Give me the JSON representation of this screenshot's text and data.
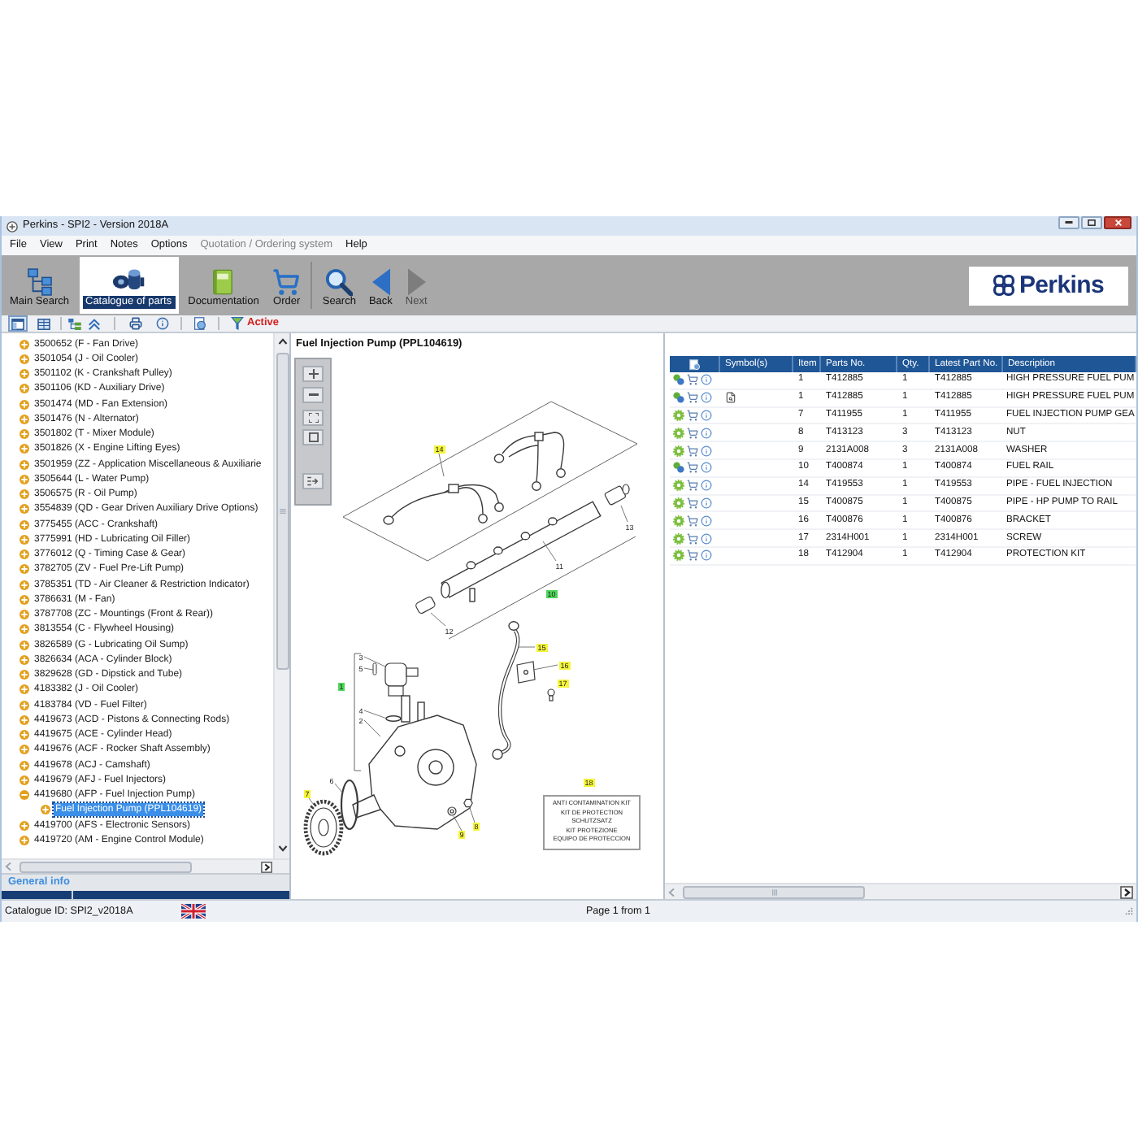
{
  "window": {
    "title": "Perkins - SPI2 - Version 2018A"
  },
  "menu": [
    {
      "label": "File",
      "disabled": false
    },
    {
      "label": "View",
      "disabled": false
    },
    {
      "label": "Print",
      "disabled": false
    },
    {
      "label": "Notes",
      "disabled": false
    },
    {
      "label": "Options",
      "disabled": false
    },
    {
      "label": "Quotation / Ordering system",
      "disabled": true
    },
    {
      "label": "Help",
      "disabled": false
    }
  ],
  "toolbar": {
    "groups": [
      [
        {
          "kind": "tree",
          "label": "Main Search",
          "selected": false,
          "disabled": false
        },
        {
          "kind": "parts",
          "label": "Catalogue of parts",
          "selected": true,
          "disabled": false
        },
        {
          "kind": "book",
          "label": "Documentation",
          "selected": false,
          "disabled": false
        },
        {
          "kind": "cart",
          "label": "Order",
          "selected": false,
          "disabled": false
        }
      ],
      [
        {
          "kind": "search",
          "label": "Search",
          "selected": false,
          "disabled": false
        },
        {
          "kind": "back",
          "label": "Back",
          "selected": false,
          "disabled": false
        },
        {
          "kind": "next",
          "label": "Next",
          "selected": false,
          "disabled": true
        }
      ]
    ],
    "logo": "Perkins"
  },
  "view_toolbar": {
    "view_buttons": [
      {
        "selected": true
      },
      {
        "selected": false
      }
    ],
    "filter": {
      "label": "Active"
    }
  },
  "tree": {
    "items": [
      {
        "label": "3500652 (F - Fan Drive)",
        "expanded": false,
        "selected": false
      },
      {
        "label": "3501054 (J - Oil Cooler)",
        "expanded": false,
        "selected": false
      },
      {
        "label": "3501102 (K - Crankshaft Pulley)",
        "expanded": false,
        "selected": false
      },
      {
        "label": "3501106 (KD - Auxiliary Drive)",
        "expanded": false,
        "selected": false
      },
      {
        "label": "3501474 (MD - Fan Extension)",
        "expanded": false,
        "selected": false
      },
      {
        "label": "3501476 (N - Alternator)",
        "expanded": false,
        "selected": false
      },
      {
        "label": "3501802 (T - Mixer Module)",
        "expanded": false,
        "selected": false
      },
      {
        "label": "3501826 (X - Engine Lifting Eyes)",
        "expanded": false,
        "selected": false
      },
      {
        "label": "3501959 (ZZ - Application Miscellaneous & Auxiliarie",
        "expanded": false,
        "selected": false
      },
      {
        "label": "3505644 (L - Water Pump)",
        "expanded": false,
        "selected": false
      },
      {
        "label": "3506575 (R - Oil Pump)",
        "expanded": false,
        "selected": false
      },
      {
        "label": "3554839 (QD - Gear Driven Auxiliary Drive Options)",
        "expanded": false,
        "selected": false
      },
      {
        "label": "3775455 (ACC - Crankshaft)",
        "expanded": false,
        "selected": false
      },
      {
        "label": "3775991 (HD - Lubricating Oil Filler)",
        "expanded": false,
        "selected": false
      },
      {
        "label": "3776012 (Q - Timing Case & Gear)",
        "expanded": false,
        "selected": false
      },
      {
        "label": "3782705 (ZV - Fuel Pre-Lift Pump)",
        "expanded": false,
        "selected": false
      },
      {
        "label": "3785351 (TD - Air Cleaner & Restriction Indicator)",
        "expanded": false,
        "selected": false
      },
      {
        "label": "3786631 (M - Fan)",
        "expanded": false,
        "selected": false
      },
      {
        "label": "3787708 (ZC - Mountings (Front & Rear))",
        "expanded": false,
        "selected": false
      },
      {
        "label": "3813554 (C - Flywheel Housing)",
        "expanded": false,
        "selected": false
      },
      {
        "label": "3826589 (G - Lubricating Oil Sump)",
        "expanded": false,
        "selected": false
      },
      {
        "label": "3826634 (ACA - Cylinder Block)",
        "expanded": false,
        "selected": false
      },
      {
        "label": "3829628 (GD - Dipstick and Tube)",
        "expanded": false,
        "selected": false
      },
      {
        "label": "4183382 (J - Oil Cooler)",
        "expanded": false,
        "selected": false
      },
      {
        "label": "4183784 (VD - Fuel Filter)",
        "expanded": false,
        "selected": false
      },
      {
        "label": "4419673 (ACD - Pistons & Connecting Rods)",
        "expanded": false,
        "selected": false
      },
      {
        "label": "4419675 (ACE - Cylinder Head)",
        "expanded": false,
        "selected": false
      },
      {
        "label": "4419676 (ACF - Rocker Shaft Assembly)",
        "expanded": false,
        "selected": false
      },
      {
        "label": "4419678 (ACJ - Camshaft)",
        "expanded": false,
        "selected": false
      },
      {
        "label": "4419679 (AFJ - Fuel Injectors)",
        "expanded": false,
        "selected": false
      },
      {
        "label": "4419680 (AFP - Fuel Injection Pump)",
        "expanded": true,
        "selected": false,
        "children": [
          {
            "label": "Fuel Injection Pump (PPL104619)",
            "expanded": false,
            "selected": true
          }
        ]
      },
      {
        "label": "4419700 (AFS - Electronic Sensors)",
        "expanded": false,
        "selected": false
      },
      {
        "label": "4419720 (AM - Engine Control Module)",
        "expanded": false,
        "selected": false
      }
    ]
  },
  "general_info": {
    "label": "General info"
  },
  "diagram": {
    "title": "Fuel Injection Pump (PPL104619)",
    "callouts": [
      {
        "label": "14",
        "color": "#f5f53b"
      },
      {
        "label": "13"
      },
      {
        "label": "11"
      },
      {
        "label": "10",
        "color": "#4fd65a"
      },
      {
        "label": "12"
      },
      {
        "label": "15",
        "color": "#f5f53b"
      },
      {
        "label": "3"
      },
      {
        "label": "16",
        "color": "#f5f53b"
      },
      {
        "label": "5"
      },
      {
        "label": "17",
        "color": "#f5f53b"
      },
      {
        "label": "1",
        "color": "#4fd65a"
      },
      {
        "label": "4"
      },
      {
        "label": "2"
      },
      {
        "label": "6"
      },
      {
        "label": "18",
        "color": "#f5f53b"
      },
      {
        "label": "7",
        "color": "#f5f53b"
      },
      {
        "label": "8",
        "color": "#f5f53b"
      },
      {
        "label": "9",
        "color": "#f5f53b"
      }
    ],
    "kit_label": [
      "ANTI CONTAMINATION KIT",
      "KIT DE PROTECTION",
      "SCHUTZSATZ",
      "KIT PROTEZIONE",
      "EQUIPO DE PROTECCION"
    ]
  },
  "parts_table": {
    "columns": [
      "Symbol(s)",
      "Item",
      "Parts No.",
      "Qty.",
      "Latest Part No.",
      "Description"
    ],
    "rows": [
      {
        "kind": "group",
        "symbol": false,
        "item": "1",
        "parts_no": "T412885",
        "qty": "1",
        "latest_part_no": "T412885",
        "description": "HIGH PRESSURE FUEL PUM"
      },
      {
        "kind": "group",
        "symbol": true,
        "item": "1",
        "parts_no": "T412885",
        "qty": "1",
        "latest_part_no": "T412885",
        "description": "HIGH PRESSURE FUEL PUM"
      },
      {
        "kind": "part",
        "symbol": false,
        "item": "7",
        "parts_no": "T411955",
        "qty": "1",
        "latest_part_no": "T411955",
        "description": "FUEL INJECTION PUMP GEA"
      },
      {
        "kind": "part",
        "symbol": false,
        "item": "8",
        "parts_no": "T413123",
        "qty": "3",
        "latest_part_no": "T413123",
        "description": "NUT"
      },
      {
        "kind": "part",
        "symbol": false,
        "item": "9",
        "parts_no": "2131A008",
        "qty": "3",
        "latest_part_no": "2131A008",
        "description": "WASHER"
      },
      {
        "kind": "group",
        "symbol": false,
        "item": "10",
        "parts_no": "T400874",
        "qty": "1",
        "latest_part_no": "T400874",
        "description": "FUEL RAIL"
      },
      {
        "kind": "part",
        "symbol": false,
        "item": "14",
        "parts_no": "T419553",
        "qty": "1",
        "latest_part_no": "T419553",
        "description": "PIPE - FUEL INJECTION"
      },
      {
        "kind": "part",
        "symbol": false,
        "item": "15",
        "parts_no": "T400875",
        "qty": "1",
        "latest_part_no": "T400875",
        "description": "PIPE - HP PUMP TO RAIL"
      },
      {
        "kind": "part",
        "symbol": false,
        "item": "16",
        "parts_no": "T400876",
        "qty": "1",
        "latest_part_no": "T400876",
        "description": "BRACKET"
      },
      {
        "kind": "part",
        "symbol": false,
        "item": "17",
        "parts_no": "2314H001",
        "qty": "1",
        "latest_part_no": "2314H001",
        "description": "SCREW"
      },
      {
        "kind": "part",
        "symbol": false,
        "item": "18",
        "parts_no": "T412904",
        "qty": "1",
        "latest_part_no": "T412904",
        "description": "PROTECTION KIT"
      }
    ]
  },
  "status_bar": {
    "catalogue_id": "Catalogue ID: SPI2_v2018A",
    "page": "Page 1 from 1"
  }
}
